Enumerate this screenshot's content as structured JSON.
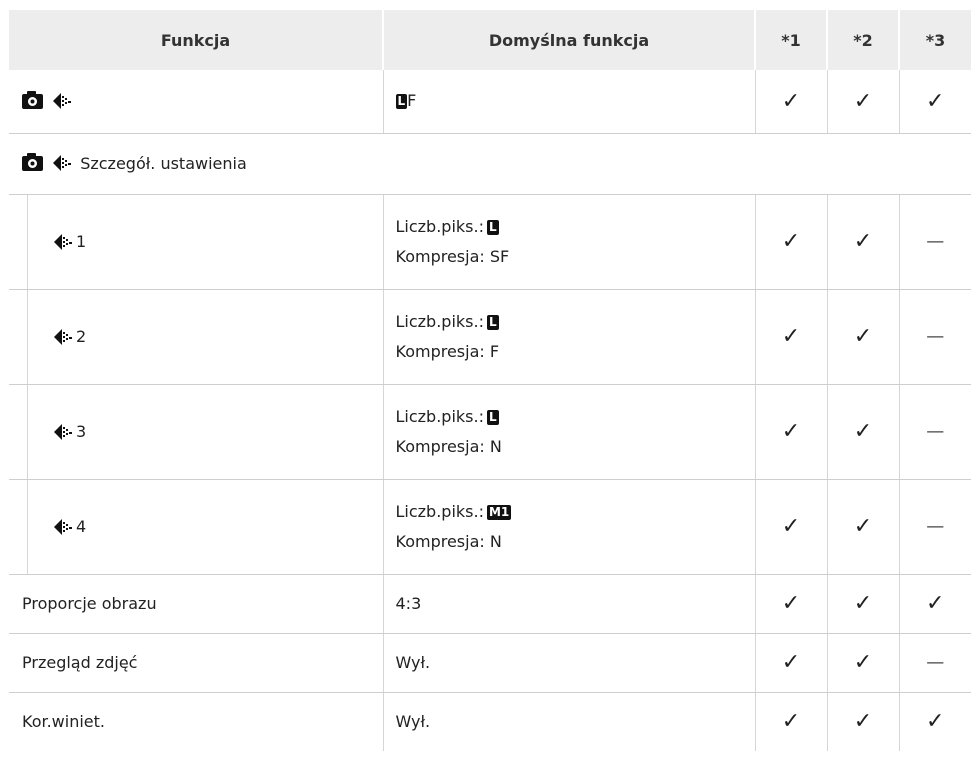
{
  "headers": {
    "func": "Funkcja",
    "default": "Domyślna funkcja",
    "c1": "*1",
    "c2": "*2",
    "c3": "*3"
  },
  "row1": {
    "default_suffix": "F",
    "badge": "L",
    "c1": "✓",
    "c2": "✓",
    "c3": "✓"
  },
  "section": {
    "label": "Szczegół. ustawienia"
  },
  "sub_rows": [
    {
      "num": "1",
      "pix_label": "Liczb.piks.:",
      "pix_badge": "L",
      "compression": "Kompresja: SF",
      "c1": "✓",
      "c2": "✓",
      "c3": "—"
    },
    {
      "num": "2",
      "pix_label": "Liczb.piks.:",
      "pix_badge": "L",
      "compression": "Kompresja: F",
      "c1": "✓",
      "c2": "✓",
      "c3": "—"
    },
    {
      "num": "3",
      "pix_label": "Liczb.piks.:",
      "pix_badge": "L",
      "compression": "Kompresja: N",
      "c1": "✓",
      "c2": "✓",
      "c3": "—"
    },
    {
      "num": "4",
      "pix_label": "Liczb.piks.:",
      "pix_badge": "M1",
      "compression": "Kompresja: N",
      "c1": "✓",
      "c2": "✓",
      "c3": "—"
    }
  ],
  "rows": [
    {
      "func": "Proporcje obrazu",
      "default": "4:3",
      "c1": "✓",
      "c2": "✓",
      "c3": "✓"
    },
    {
      "func": "Przegląd zdjęć",
      "default": "Wył.",
      "c1": "✓",
      "c2": "✓",
      "c3": "—"
    },
    {
      "func": "Kor.winiet.",
      "default": "Wył.",
      "c1": "✓",
      "c2": "✓",
      "c3": "✓"
    }
  ],
  "icons": {
    "camera": "camera-icon",
    "quality": "image-quality-icon"
  }
}
